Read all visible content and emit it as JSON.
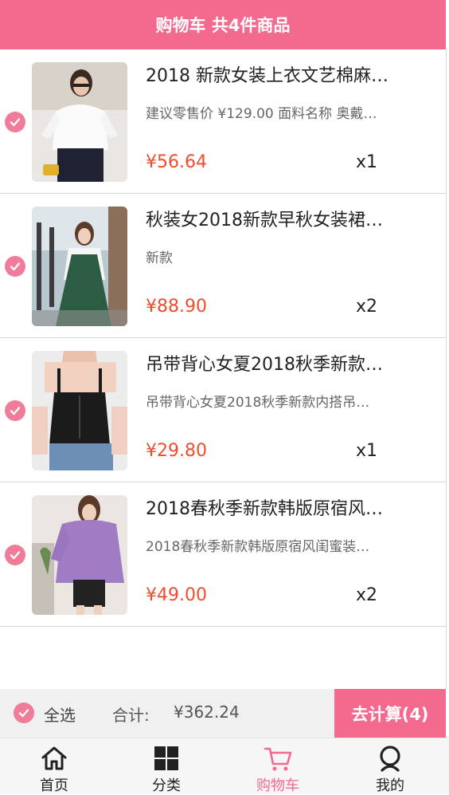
{
  "header": {
    "title": "购物车 共4件商品"
  },
  "items": [
    {
      "title": "2018 新款女装上衣文艺棉麻…",
      "desc": "建议零售价 ¥129.00 面料名称 奥戴…",
      "price": "¥56.64",
      "qty": "x1"
    },
    {
      "title": "秋装女2018新款早秋女装裙…",
      "desc": "新款",
      "price": "¥88.90",
      "qty": "x2"
    },
    {
      "title": "吊带背心女夏2018秋季新款…",
      "desc": "吊带背心女夏2018秋季新款内搭吊…",
      "price": "¥29.80",
      "qty": "x1"
    },
    {
      "title": "2018春秋季新款韩版原宿风…",
      "desc": "2018春秋季新款韩版原宿风闺蜜装…",
      "price": "¥49.00",
      "qty": "x2"
    }
  ],
  "footer": {
    "select_all": "全选",
    "total_label": "合计:",
    "total": "¥362.24",
    "checkout": "去计算(4)"
  },
  "tabs": [
    {
      "label": "首页",
      "icon": "home-icon"
    },
    {
      "label": "分类",
      "icon": "grid-icon"
    },
    {
      "label": "购物车",
      "icon": "cart-icon",
      "active": true
    },
    {
      "label": "我的",
      "icon": "user-icon"
    }
  ],
  "colors": {
    "brand": "#f36a8e",
    "price": "#f04c2e",
    "check": "#f07c9a"
  }
}
